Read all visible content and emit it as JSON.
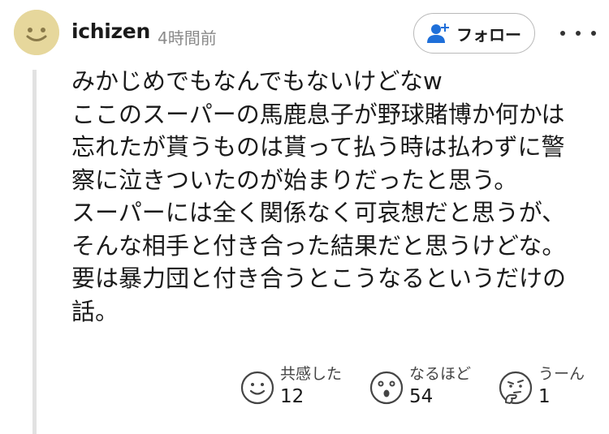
{
  "comment": {
    "username": "ichizen",
    "time": "4時間前",
    "follow_label": "フォロー",
    "lines": [
      "みかじめでもなんでもないけどなw",
      "ここのスーパーの馬鹿息子が野球賭博か何かは",
      "忘れたが貰うものは貰って払う時は払わずに警",
      "察に泣きついたのが始まりだったと思う。",
      "スーパーには全く関係なく可哀想だと思うが、",
      "そんな相手と付き合った結果だと思うけどな。",
      "要は暴力団と付き合うとこうなるというだけの",
      "話。"
    ]
  },
  "reactions": [
    {
      "label": "共感した",
      "count": "12",
      "icon": "smile-face-icon"
    },
    {
      "label": "なるほど",
      "count": "54",
      "icon": "surprised-face-icon"
    },
    {
      "label": "うーん",
      "count": "1",
      "icon": "thinking-face-icon"
    }
  ],
  "icons": {
    "avatar": "smiley-avatar-icon",
    "follow": "add-user-icon",
    "more": "more-dots-icon"
  },
  "colors": {
    "avatar_bg": "#e6d79c",
    "follow_icon": "#1e6fd9",
    "muted_text": "#8a8a8a",
    "thread_line": "#e2e2e2"
  }
}
